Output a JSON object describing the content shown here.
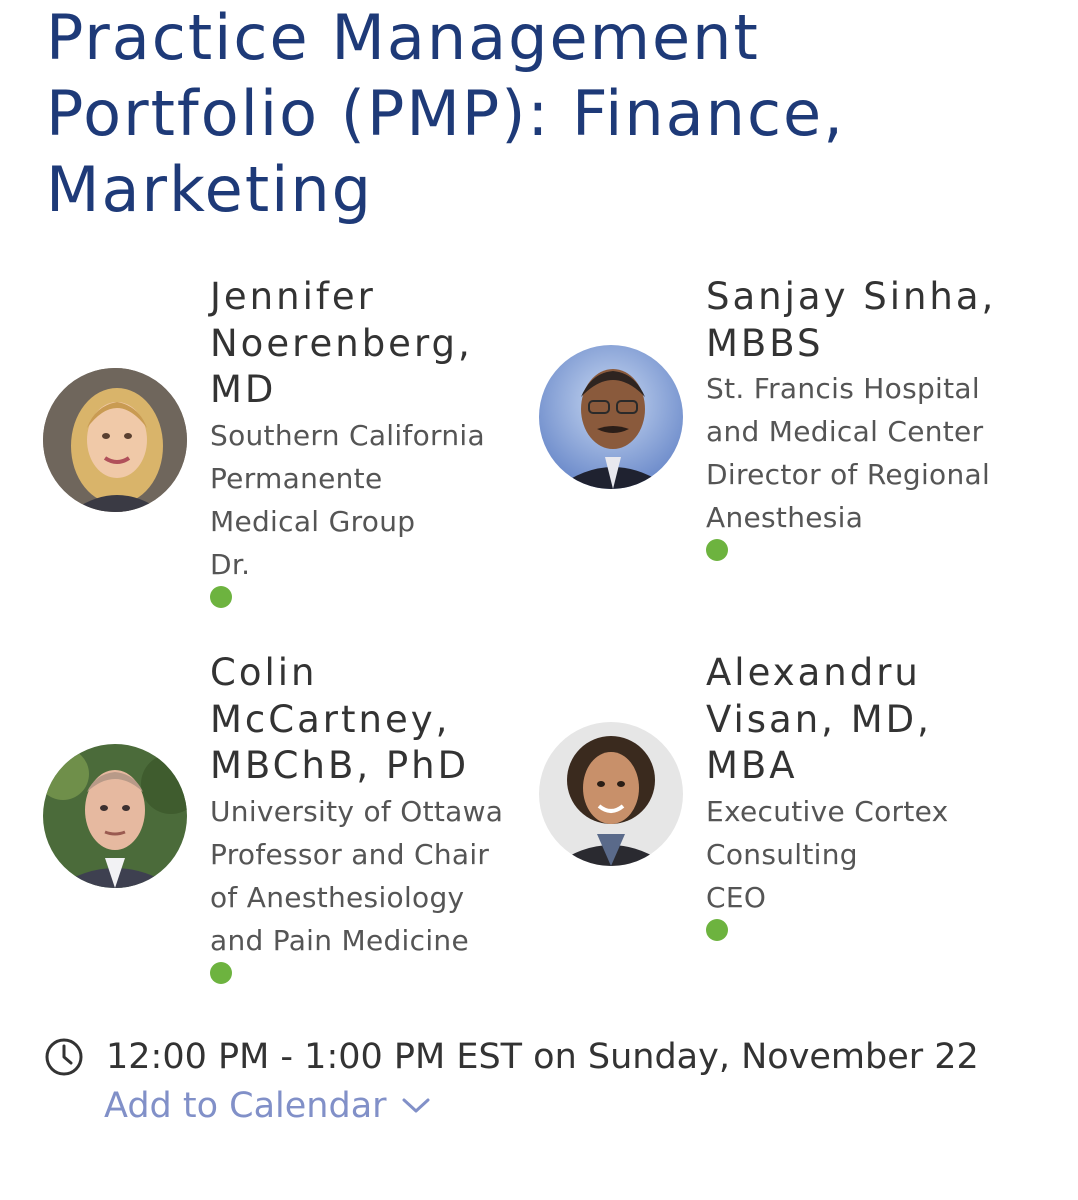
{
  "session": {
    "title_lines": [
      "Practice Management",
      "Portfolio (PMP): Finance,",
      "Marketing"
    ]
  },
  "speakers": [
    {
      "name_lines": [
        "Jennifer",
        "Noerenberg,",
        "MD"
      ],
      "detail_lines": [
        "Southern California",
        "Permanente",
        "Medical Group",
        "Dr."
      ],
      "status_color": "#6db33f"
    },
    {
      "name_lines": [
        "Sanjay Sinha,",
        "MBBS"
      ],
      "detail_lines": [
        "St. Francis Hospital",
        "and Medical Center",
        "Director of Regional",
        "Anesthesia"
      ],
      "status_color": "#6db33f"
    },
    {
      "name_lines": [
        "Colin",
        "McCartney,",
        "MBChB, PhD"
      ],
      "detail_lines": [
        "University of Ottawa",
        "Professor and Chair",
        "of Anesthesiology",
        "and Pain Medicine"
      ],
      "status_color": "#6db33f"
    },
    {
      "name_lines": [
        "Alexandru",
        "Visan, MD,",
        "MBA"
      ],
      "detail_lines": [
        "Executive Cortex",
        "Consulting",
        "CEO"
      ],
      "status_color": "#6db33f"
    }
  ],
  "schedule": {
    "time_text": "12:00 PM - 1:00 PM EST on Sunday, November 22",
    "add_to_calendar_label": "Add to Calendar",
    "clock_icon": "clock-icon",
    "chevron_icon": "chevron-down-icon"
  },
  "colors": {
    "title": "#1e3a78",
    "link": "#8190c8",
    "status_dot": "#6db33f"
  }
}
